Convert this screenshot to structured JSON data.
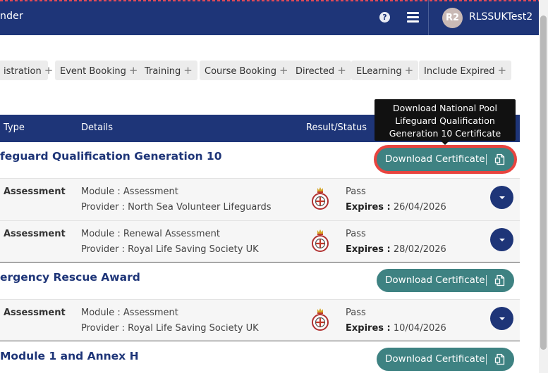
{
  "header": {
    "app_title": "nder",
    "help_symbol": "?",
    "avatar_initials": "R2",
    "username": "RLSSUKTest2"
  },
  "filters": [
    {
      "label": "istration"
    },
    {
      "label": "Event Booking"
    },
    {
      "label": "Training"
    },
    {
      "label": "Course Booking"
    },
    {
      "label": "Directed"
    },
    {
      "label": "ELearning"
    },
    {
      "label": "Include Expired"
    }
  ],
  "filter_add_symbol": "+",
  "table": {
    "columns": {
      "type": "Type",
      "details": "Details",
      "result": "Result/Status"
    }
  },
  "tooltip": {
    "line1": "Download National Pool",
    "line2": "Lifeguard Qualification",
    "line3": "Generation 10 Certificate"
  },
  "groups": [
    {
      "title": "feguard Qualification Generation 10",
      "button_label": "Download Certificate",
      "rows": [
        {
          "type": "Assessment",
          "module": "Module : Assessment",
          "provider": "Provider : North Sea Volunteer Lifeguards",
          "result": "Pass",
          "expires_label": "Expires :",
          "expires": "26/04/2026"
        },
        {
          "type": "Assessment",
          "module": "Module : Renewal Assessment",
          "provider": "Provider : Royal Life Saving Society UK",
          "result": "Pass",
          "expires_label": "Expires :",
          "expires": "28/02/2026"
        }
      ]
    },
    {
      "title": "ergency Rescue Award",
      "button_label": "Download Certificate",
      "rows": [
        {
          "type": "Assessment",
          "module": "Module : Assessment",
          "provider": "Provider : Royal Life Saving Society UK",
          "result": "Pass",
          "expires_label": "Expires :",
          "expires": "10/04/2026"
        }
      ]
    },
    {
      "title": "Module 1 and Annex H",
      "button_label": "Download Certificate",
      "rows": []
    }
  ],
  "colors": {
    "primary": "#1e3578",
    "button": "#3e8282",
    "focus_ring": "#e8443f"
  }
}
